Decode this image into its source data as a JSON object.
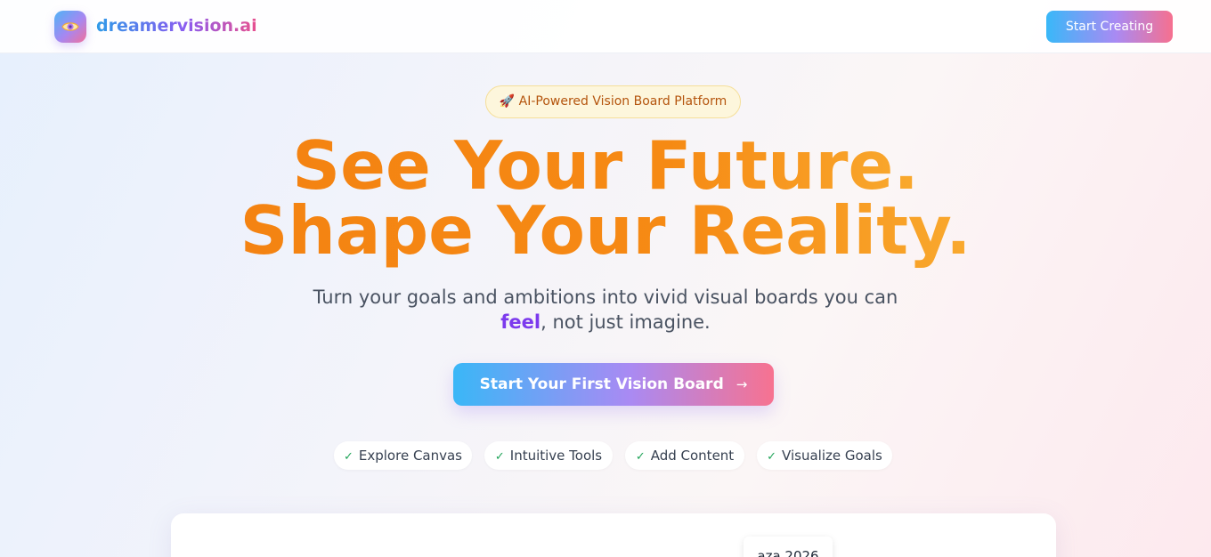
{
  "nav": {
    "brand": "dreamervision.ai",
    "cta_label": "Start Creating",
    "logo_icon": "eye-icon"
  },
  "hero": {
    "badge": "🚀 AI-Powered Vision Board Platform",
    "title_line1": "See Your Future.",
    "title_line2": "Shape Your Reality.",
    "subtitle_before": "Turn your goals and ambitions into vivid visual boards you can",
    "subtitle_accent": "feel",
    "subtitle_after": ", not just imagine.",
    "cta_label": "Start Your First Vision Board",
    "cta_icon": "→"
  },
  "features": [
    {
      "label": "Explore Canvas",
      "icon": "✓"
    },
    {
      "label": "Intuitive Tools",
      "icon": "✓"
    },
    {
      "label": "Add Content",
      "icon": "✓"
    },
    {
      "label": "Visualize Goals",
      "icon": "✓"
    }
  ],
  "preview": {
    "tag_text": "aza 2026"
  },
  "colors": {
    "accent_orange": "#f68a14",
    "accent_purple": "#7c3aed",
    "gradient_start": "#39b8f8",
    "gradient_mid": "#a98af3",
    "gradient_end": "#f6708f",
    "check_green": "#22a55a"
  }
}
